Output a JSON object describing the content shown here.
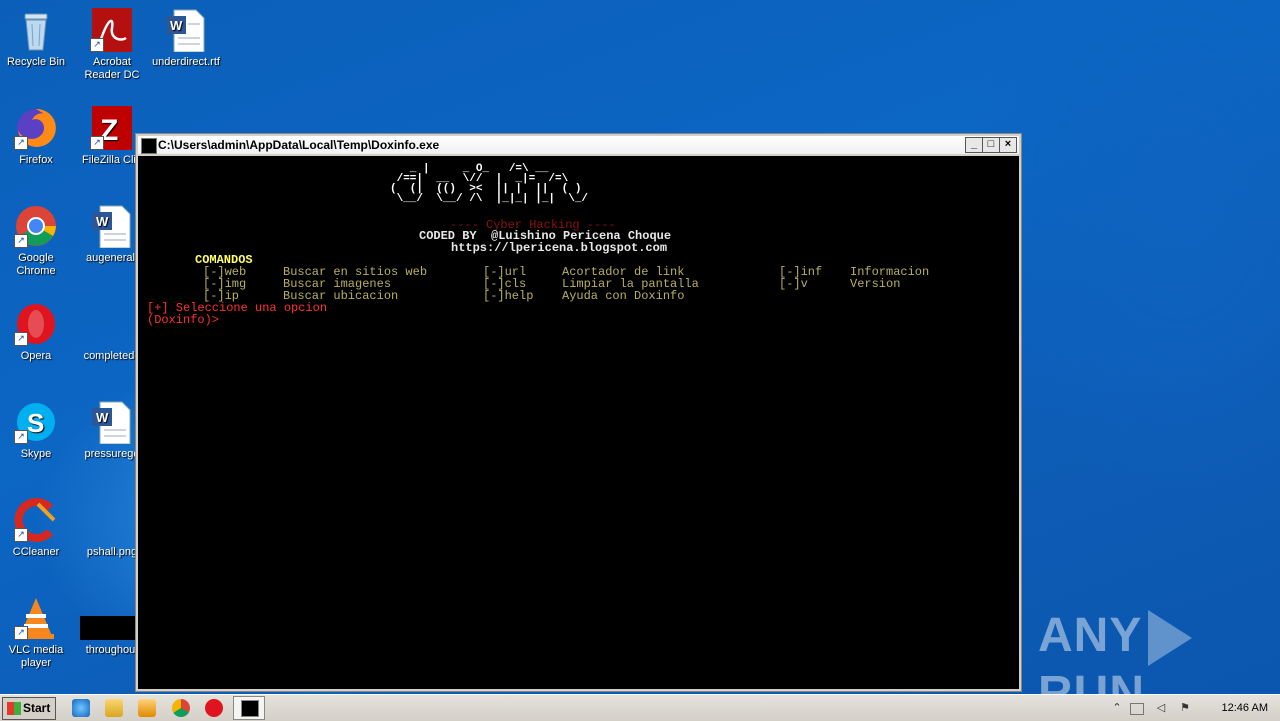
{
  "desktop": {
    "icons": [
      {
        "label": "Recycle Bin",
        "icon": "recycle-bin-icon"
      },
      {
        "label": "Acrobat Reader DC",
        "icon": "acrobat-icon"
      },
      {
        "label": "underdirect.rtf",
        "icon": "word-document-icon"
      },
      {
        "label": "Firefox",
        "icon": "firefox-icon"
      },
      {
        "label": "FileZilla Clie",
        "icon": "filezilla-icon"
      },
      {
        "label": "Google Chrome",
        "icon": "chrome-icon"
      },
      {
        "label": "augeneral.",
        "icon": "word-document-icon"
      },
      {
        "label": "Opera",
        "icon": "opera-icon"
      },
      {
        "label": "completedg",
        "icon": "blank-icon"
      },
      {
        "label": "Skype",
        "icon": "skype-icon"
      },
      {
        "label": "pressurego",
        "icon": "word-document-icon"
      },
      {
        "label": "CCleaner",
        "icon": "ccleaner-icon"
      },
      {
        "label": "pshall.png",
        "icon": "image-icon"
      },
      {
        "label": "VLC media player",
        "icon": "vlc-icon"
      },
      {
        "label": "throughout",
        "icon": "black-image-icon"
      }
    ]
  },
  "console": {
    "title": "C:\\Users\\admin\\AppData\\Local\\Temp\\Doxinfo.exe",
    "art": [
      "   _ |     _ O_   /=\\ __",
      " /==|  __  \\//  |  _|=  /=\\",
      "(  (|  (()  ><  || |  ||  ( )",
      " \\__/  \\__/ /\\  |_|_| |_|  \\_/"
    ],
    "subtitle": "---- Cyber Hacking ----",
    "coded_by": "CODED BY  @Luishino Pericena Choque",
    "url": "https://lpericena.blogspot.com",
    "commands_header": "COMANDOS",
    "commands": [
      [
        "[-]web",
        "Buscar en sitios web",
        "[-]url",
        "Acortador de link",
        "[-]inf",
        "Informacion"
      ],
      [
        "[-]img",
        "Buscar imagenes",
        "[-]cls",
        "Limpiar la pantalla",
        "[-]v",
        "Version"
      ],
      [
        "[-]ip",
        "Buscar ubicacion",
        "[-]help",
        "Ayuda con Doxinfo",
        "",
        ""
      ]
    ],
    "select_prompt": "[+] Seleccione una opcion",
    "prompt": "(Doxinfo)>"
  },
  "taskbar": {
    "start_label": "Start",
    "clock": "12:46 AM",
    "quick_launch": [
      "ie-icon",
      "explorer-folder-icon",
      "media-player-icon",
      "chrome-icon",
      "opera-icon",
      "console-app-icon"
    ]
  },
  "watermark": {
    "left": "ANY",
    "right": "RUN"
  }
}
